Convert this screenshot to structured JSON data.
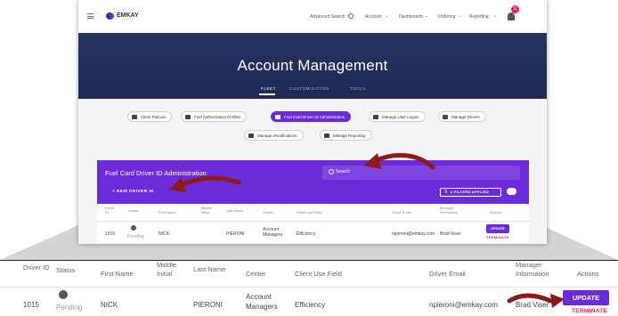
{
  "app": {
    "name": "EMKAY",
    "notification_count": "11"
  },
  "nav": {
    "advanced_search": "Advanced Search",
    "account": "Account",
    "dashboards": "Dashboards",
    "ordering": "Ordering",
    "reporting": "Reporting"
  },
  "hero": {
    "title": "Account Management",
    "tabs": [
      "FLEET",
      "CUSTOMIZATION",
      "TOOLS"
    ]
  },
  "chips": [
    "Client Policies",
    "Fuel Authorization Profiles",
    "Fuel Card Driver ID Administration",
    "Manage User Logins",
    "Manage Drivers",
    "Manage eNotifications",
    "Mileage Reporting"
  ],
  "panel": {
    "title": "Fuel Card Driver ID Administration",
    "search_placeholder": "Search",
    "new_button": "+ NEW DRIVER ID",
    "filters": "2 FILTERS APPLIED"
  },
  "table": {
    "headers": [
      "Driver ID",
      "Status",
      "First Name",
      "Middle Initial",
      "Last Name",
      "Center",
      "Client Use Field",
      "Driver Email",
      "Manager Information",
      "Actions"
    ],
    "row": {
      "driver_id": "1015",
      "status": "Pending",
      "first_name": "NICK",
      "last_name": "PIERONI",
      "center": "Account Managers",
      "client_use": "Efficiency",
      "email": "npieroni@emkay.com",
      "manager": "Brad Viser",
      "update": "UPDATE",
      "terminate": "TERMINATE"
    }
  },
  "colors": {
    "accent": "#6c2bd9",
    "hero": "#1e2a55",
    "annotation": "#8b1a1a",
    "terminate": "#e0245e"
  }
}
